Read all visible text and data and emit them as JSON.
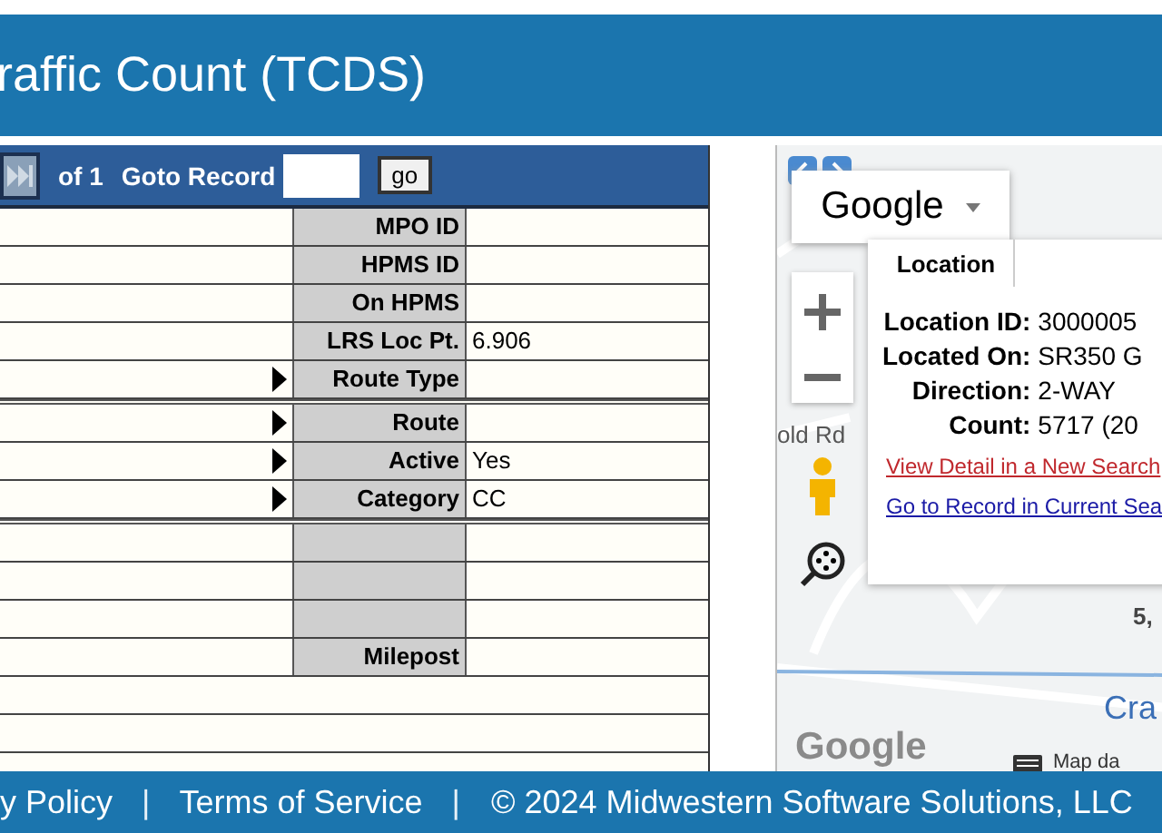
{
  "header": {
    "title": "raffic Count (TCDS)"
  },
  "pager": {
    "of_text": "of 1",
    "goto_label": "Goto Record",
    "go_button": "go"
  },
  "field_groups": [
    [
      {
        "label": "MPO ID",
        "kind": "text"
      },
      {
        "label": "HPMS ID",
        "kind": "text"
      },
      {
        "label": "On HPMS",
        "kind": "text"
      },
      {
        "label": "LRS Loc Pt.",
        "value": "6.906",
        "kind": "text"
      },
      {
        "label": "Route Type",
        "kind": "select"
      }
    ],
    [
      {
        "label": "Route",
        "kind": "select"
      },
      {
        "label": "Active",
        "value": "Yes",
        "kind": "select"
      },
      {
        "label": "Category",
        "value": "CC",
        "kind": "select"
      }
    ],
    [
      {
        "kind": "text"
      },
      {
        "kind": "text"
      },
      {
        "kind": "text"
      },
      {
        "label": "Milepost",
        "kind": "text"
      }
    ]
  ],
  "map": {
    "map_type": "Google",
    "tab": "Location",
    "info": [
      {
        "label": "Location ID:",
        "value": "3000005"
      },
      {
        "label": "Located On:",
        "value": "SR350 G"
      },
      {
        "label": "Direction:",
        "value": "2-WAY"
      },
      {
        "label": "Count:",
        "value": "5717 (20"
      }
    ],
    "links": [
      {
        "text": "View Detail in a New Search",
        "visited": true
      },
      {
        "text": "Go to Record in Current Sea",
        "visited": false
      }
    ],
    "road_label": "old Rd",
    "place_label": "Cra",
    "number_label": "5,",
    "logo": "Google",
    "attribution": "Map da"
  },
  "footer": {
    "items": [
      {
        "kind": "link",
        "text": "y Policy"
      },
      {
        "kind": "separator",
        "text": "|"
      },
      {
        "kind": "link",
        "text": "Terms of Service"
      },
      {
        "kind": "separator",
        "text": "|"
      },
      {
        "kind": "text",
        "text": "© 2024 Midwestern Software Solutions, LLC"
      }
    ]
  }
}
